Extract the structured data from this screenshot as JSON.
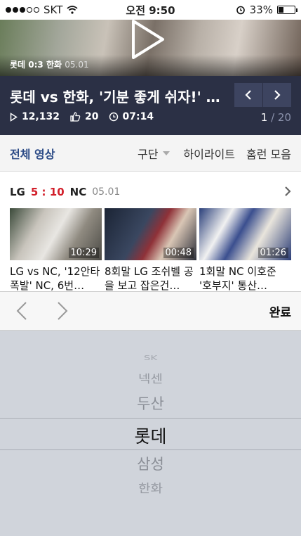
{
  "status_bar": {
    "carrier": "SKT",
    "time": "오전 9:50",
    "battery": "33%",
    "battery_level": 0.33
  },
  "video": {
    "team": "롯데",
    "score": "0:3",
    "opponent": "한화",
    "date": "05.01"
  },
  "title_bar": {
    "title": "롯데 vs 한화, '기분 좋게 쉬자!' …",
    "views": "12,132",
    "likes": "20",
    "duration": "07:14",
    "page_current": "1",
    "page_sep": "/",
    "page_total": "20"
  },
  "tabs": {
    "all": "전체 영상",
    "segment": "구단",
    "highlight": "하이라이트",
    "homerun": "홈런 모음"
  },
  "game": {
    "home": "LG",
    "score": "5 : 10",
    "away": "NC",
    "date": "05.01",
    "clips": [
      {
        "duration": "10:29",
        "caption": "LG vs NC, '12안타 폭발' NC, 6번…"
      },
      {
        "duration": "00:48",
        "caption": "8회말 LG 조쉬벨 공을 보고 잡은건…"
      },
      {
        "duration": "01:26",
        "caption": "1회말 NC 이호준 '호부지' 통산…"
      }
    ]
  },
  "toolbar": {
    "done": "완료"
  },
  "picker": {
    "items": [
      "SK",
      "넥센",
      "두산",
      "롯데",
      "삼성",
      "한화"
    ],
    "selected": "롯데"
  }
}
